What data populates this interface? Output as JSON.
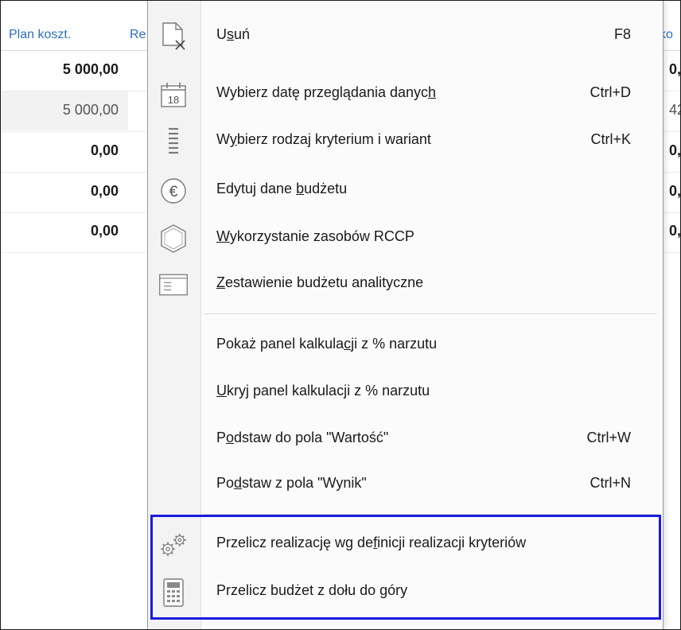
{
  "grid": {
    "headers": {
      "plan": "Plan koszt.",
      "re": "Re",
      "ko": "ko"
    },
    "rows": [
      {
        "value": "5 000,00",
        "edge": "0,",
        "style": "bold"
      },
      {
        "value": "5 000,00",
        "edge": "42",
        "style": "light"
      },
      {
        "value": "0,00",
        "edge": "0,",
        "style": "bold"
      },
      {
        "value": "0,00",
        "edge": "0,",
        "style": "bold"
      },
      {
        "value": "0,00",
        "edge": "0,",
        "style": "bold"
      }
    ]
  },
  "menu": {
    "items": [
      {
        "pre": "U",
        "ul": "s",
        "post": "uń",
        "shortcut": "F8",
        "icon": "delete-document-icon"
      },
      {
        "pre": "Wybierz datę przeglądania danyc",
        "ul": "h",
        "post": "",
        "shortcut": "Ctrl+D",
        "icon": "calendar-icon",
        "icon_text": "18"
      },
      {
        "pre": "W",
        "ul": "y",
        "post": "bierz rodzaj kryterium i wariant",
        "shortcut": "Ctrl+K",
        "icon": "criteria-list-icon"
      },
      {
        "pre": "Edytuj dane ",
        "ul": "b",
        "post": "udżetu",
        "shortcut": "",
        "icon": "euro-icon",
        "icon_text": "€"
      },
      {
        "pre": "",
        "ul": "W",
        "post": "ykorzystanie zasobów RCCP",
        "shortcut": "",
        "icon": "resource-cube-icon"
      },
      {
        "pre": "",
        "ul": "Z",
        "post": "estawienie budżetu analityczne",
        "shortcut": "",
        "icon": "analytic-report-icon"
      },
      {
        "pre": "Pokaż panel kalkula",
        "ul": "c",
        "post": "ji z % narzutu",
        "shortcut": "",
        "icon": ""
      },
      {
        "pre": "",
        "ul": "U",
        "post": "kryj panel kalkulacji z % narzutu",
        "shortcut": "",
        "icon": ""
      },
      {
        "pre": "P",
        "ul": "o",
        "post": "dstaw do pola \"Wartość\"",
        "shortcut": "Ctrl+W",
        "icon": ""
      },
      {
        "pre": "Po",
        "ul": "d",
        "post": "staw z pola \"Wynik\"",
        "shortcut": "Ctrl+N",
        "icon": ""
      },
      {
        "pre": "Przelicz realizację wg de",
        "ul": "f",
        "post": "inicji realizacji kryteriów",
        "shortcut": "",
        "icon": "gears-icon"
      },
      {
        "pre": "Przelicz budżet z dołu do ",
        "ul": "g",
        "post": "óry",
        "shortcut": "",
        "icon": "calculator-icon"
      }
    ]
  },
  "colors": {
    "highlight": "#1a1ae0",
    "header_link": "#2b6fc2"
  }
}
